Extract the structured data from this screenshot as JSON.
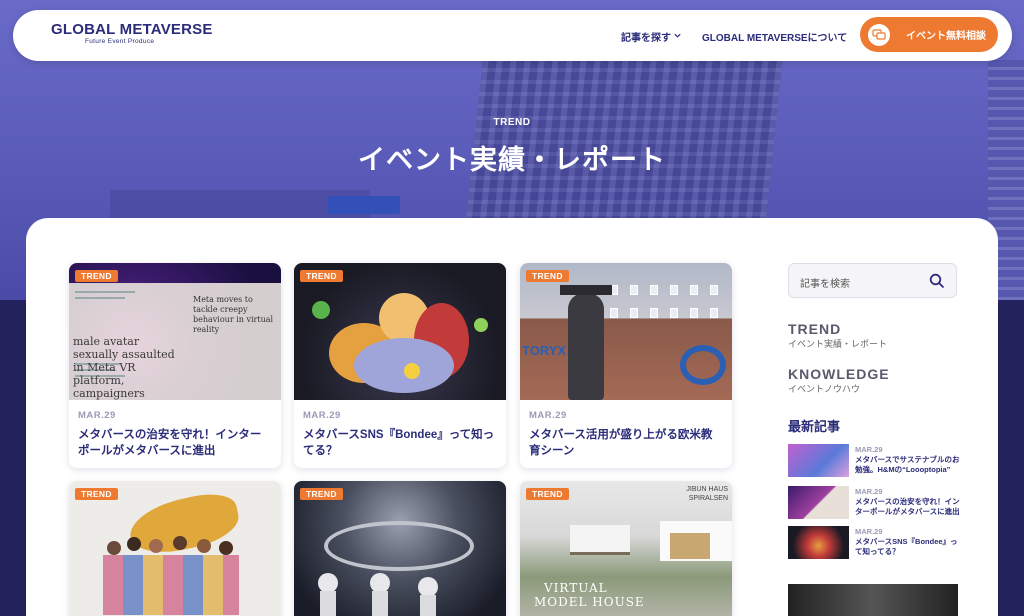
{
  "header": {
    "logo_main": "GLOBAL METAVERSE",
    "logo_sub": "Future Event Produce",
    "nav_articles": "記事を探す",
    "nav_about": "GLOBAL METAVERSEについて",
    "cta_label": "イベント無料相談"
  },
  "hero": {
    "eyebrow": "TREND",
    "title": "イベント実績・レポート"
  },
  "cards": [
    {
      "badge": "TREND",
      "date": "MAR.29",
      "title": "メタバースの治安を守れ！インターポールがメタバースに進出"
    },
    {
      "badge": "TREND",
      "date": "MAR.29",
      "title": "メタバースSNS『Bondee』って知ってる？"
    },
    {
      "badge": "TREND",
      "date": "MAR.29",
      "title": "メタバース活用が盛り上がる欧米教育シーン"
    },
    {
      "badge": "TREND"
    },
    {
      "badge": "TREND"
    },
    {
      "badge": "TREND"
    }
  ],
  "card_image_text": {
    "card1_right": "Meta moves to tackle creepy behaviour in virtual reality",
    "card1_head": "male avatar sexually assaulted in Meta VR platform, campaigners",
    "card3_overlay": "TORYX",
    "card6_top": "JIBUN HAUS SPIRALSEN",
    "card6_caption_1": "VIRTUAL",
    "card6_caption_2": "MODEL HOUSE"
  },
  "sidebar": {
    "search_placeholder": "記事を検索",
    "categories": [
      {
        "en": "TREND",
        "jp": "イベント実績・レポート"
      },
      {
        "en": "KNOWLEDGE",
        "jp": "イベントノウハウ"
      }
    ],
    "latest_heading": "最新記事",
    "latest": [
      {
        "date": "MAR.29",
        "title": "メタバースでサステナブルのお勉強。H&Mの“Loooptopia”"
      },
      {
        "date": "MAR.29",
        "title": "メタバースの治安を守れ！インターポールがメタバースに進出"
      },
      {
        "date": "MAR.29",
        "title": "メタバースSNS『Bondee』って知ってる？"
      }
    ]
  },
  "icons": [
    "chevron-down-icon",
    "chat-icon",
    "search-icon"
  ],
  "colors": {
    "accent": "#ee7a32",
    "brand": "#2b2c7a",
    "hero": "#5a5bb8"
  }
}
